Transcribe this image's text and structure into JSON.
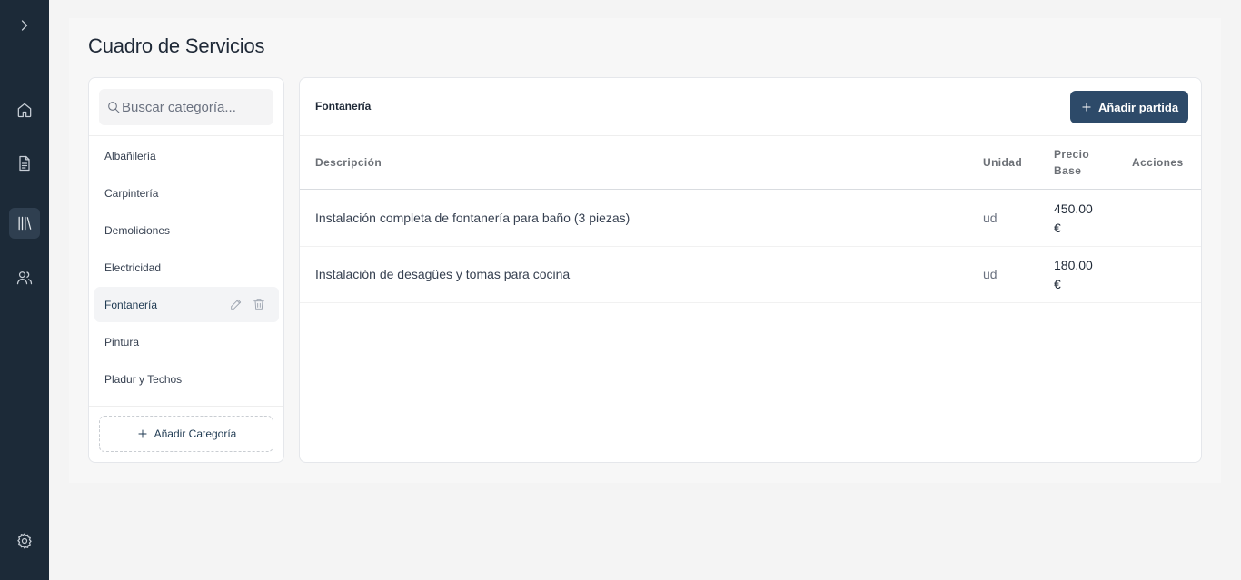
{
  "page_title": "Cuadro de Servicios",
  "nav": {
    "toggle_icon": "chevron-right-icon",
    "items": [
      {
        "icon": "home-icon"
      },
      {
        "icon": "document-icon"
      },
      {
        "icon": "library-icon",
        "active": true
      },
      {
        "icon": "users-icon"
      }
    ],
    "settings_icon": "gear-icon"
  },
  "categories": {
    "search_placeholder": "Buscar categoría...",
    "items": [
      {
        "label": "Albañilería"
      },
      {
        "label": "Carpintería"
      },
      {
        "label": "Demoliciones"
      },
      {
        "label": "Electricidad"
      },
      {
        "label": "Fontanería",
        "active": true
      },
      {
        "label": "Pintura"
      },
      {
        "label": "Pladur y Techos"
      }
    ],
    "add_label": "Añadir Categoría"
  },
  "main": {
    "section_title": "Fontanería",
    "add_button_label": "Añadir partida",
    "columns": {
      "description": "Descripción",
      "unit": "Unidad",
      "price_line1": "Precio",
      "price_line2": "Base",
      "actions": "Acciones"
    },
    "rows": [
      {
        "description": "Instalación completa de fontanería para baño (3 piezas)",
        "unit": "ud",
        "price": "450.00",
        "currency": "€"
      },
      {
        "description": "Instalación de desagües y tomas para cocina",
        "unit": "ud",
        "price": "180.00",
        "currency": "€"
      }
    ]
  },
  "colors": {
    "sidebar": "#1c2a38",
    "primary_button": "#2d4a69",
    "accent_text": "#1f3a52"
  }
}
